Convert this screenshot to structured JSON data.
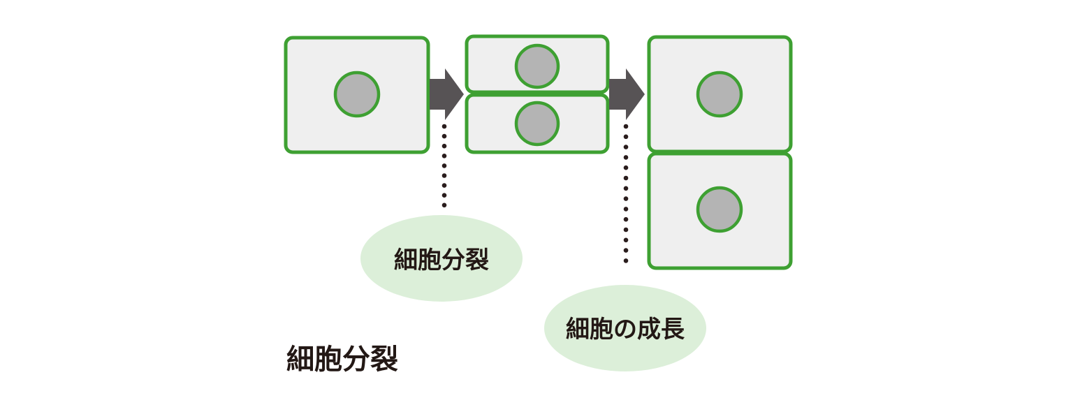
{
  "labels": {
    "division_bubble": "細胞分裂",
    "growth_bubble": "細胞の成長",
    "caption": "細胞分裂"
  },
  "colors": {
    "cell_fill": "#efefef",
    "cell_border": "#3ea032",
    "nucleus_fill": "#b4b4b4",
    "arrow": "#575355",
    "bubble_fill": "#dcefd9",
    "dots": "#2a1d1d",
    "text": "#231815"
  }
}
